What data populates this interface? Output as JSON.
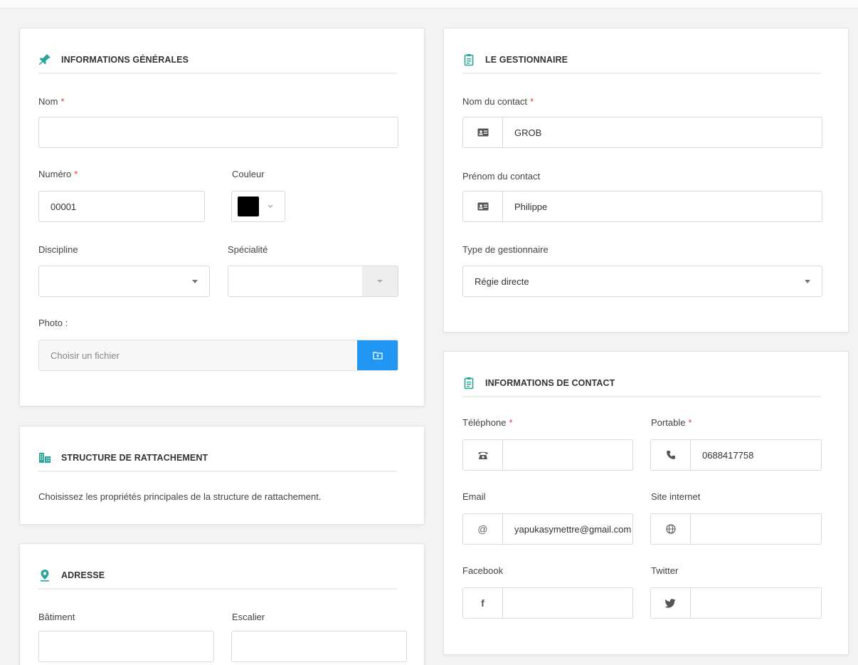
{
  "general": {
    "title": "INFORMATIONS GÉNÉRALES",
    "nom_label": "Nom",
    "nom_value": "",
    "numero_label": "Numéro",
    "numero_value": "00001",
    "couleur_label": "Couleur",
    "couleur_value": "#000000",
    "discipline_label": "Discipline",
    "specialite_label": "Spécialité",
    "photo_label": "Photo :",
    "photo_placeholder": "Choisir un fichier",
    "required_mark": "*"
  },
  "structure": {
    "title": "STRUCTURE DE RATTACHEMENT",
    "description": "Choisissez les propriétés principales de la structure de rattachement."
  },
  "adresse": {
    "title": "ADRESSE",
    "batiment_label": "Bâtiment",
    "escalier_label": "Escalier"
  },
  "gestionnaire": {
    "title": "LE GESTIONNAIRE",
    "nom_label": "Nom du contact",
    "nom_value": "GROB",
    "prenom_label": "Prénom du contact",
    "prenom_value": "Philippe",
    "type_label": "Type de gestionnaire",
    "type_value": "Régie directe"
  },
  "contact": {
    "title": "INFORMATIONS DE CONTACT",
    "telephone_label": "Téléphone",
    "telephone_value": "",
    "portable_label": "Portable",
    "portable_value": "0688417758",
    "email_label": "Email",
    "email_value": "yapukasymettre@gmail.com",
    "site_label": "Site internet",
    "facebook_label": "Facebook",
    "twitter_label": "Twitter"
  },
  "colors": {
    "accent": "#2196f3",
    "teal_icon": "#26a69a",
    "required": "#e53935"
  }
}
